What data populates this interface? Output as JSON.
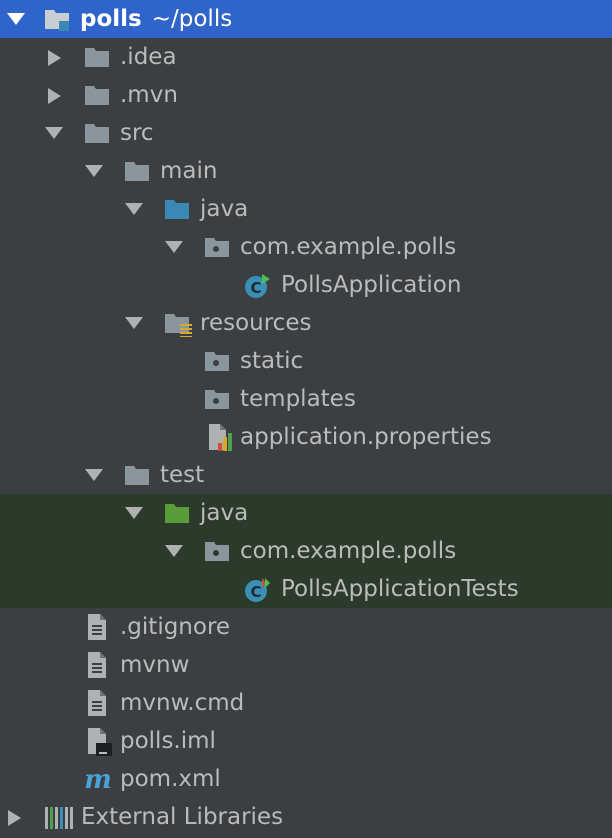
{
  "project": {
    "name": "polls",
    "path": "~/polls"
  },
  "tree": {
    "idea": ".idea",
    "mvn": ".mvn",
    "src": "src",
    "main": "main",
    "main_java": "java",
    "main_package": "com.example.polls",
    "main_class": "PollsApplication",
    "resources": "resources",
    "static": "static",
    "templates": "templates",
    "app_props": "application.properties",
    "test": "test",
    "test_java": "java",
    "test_package": "com.example.polls",
    "test_class": "PollsApplicationTests",
    "gitignore": ".gitignore",
    "mvnw": "mvnw",
    "mvnw_cmd": "mvnw.cmd",
    "iml": "polls.iml",
    "pom": "pom.xml",
    "ext_libs": "External Libraries"
  },
  "icons": {
    "folder": "folder-icon",
    "source_folder": "source-folder-icon",
    "test_folder": "test-source-folder-icon",
    "resources_folder": "resources-folder-icon",
    "package": "package-icon",
    "class": "java-class-icon",
    "properties": "properties-file-icon",
    "text_file": "text-file-icon",
    "iml_file": "iml-file-icon",
    "maven": "maven-icon",
    "libraries": "libraries-icon"
  },
  "colors": {
    "background": "#3c3f41",
    "selection": "#2f65ca",
    "test_highlight": "#2b3a2b",
    "text": "#bbbbbb",
    "folder": "#8b959c",
    "source_folder": "#3c88b4",
    "test_folder": "#5a9c3a",
    "class_badge": "#3a8fb7",
    "maven": "#4aa3d8"
  }
}
